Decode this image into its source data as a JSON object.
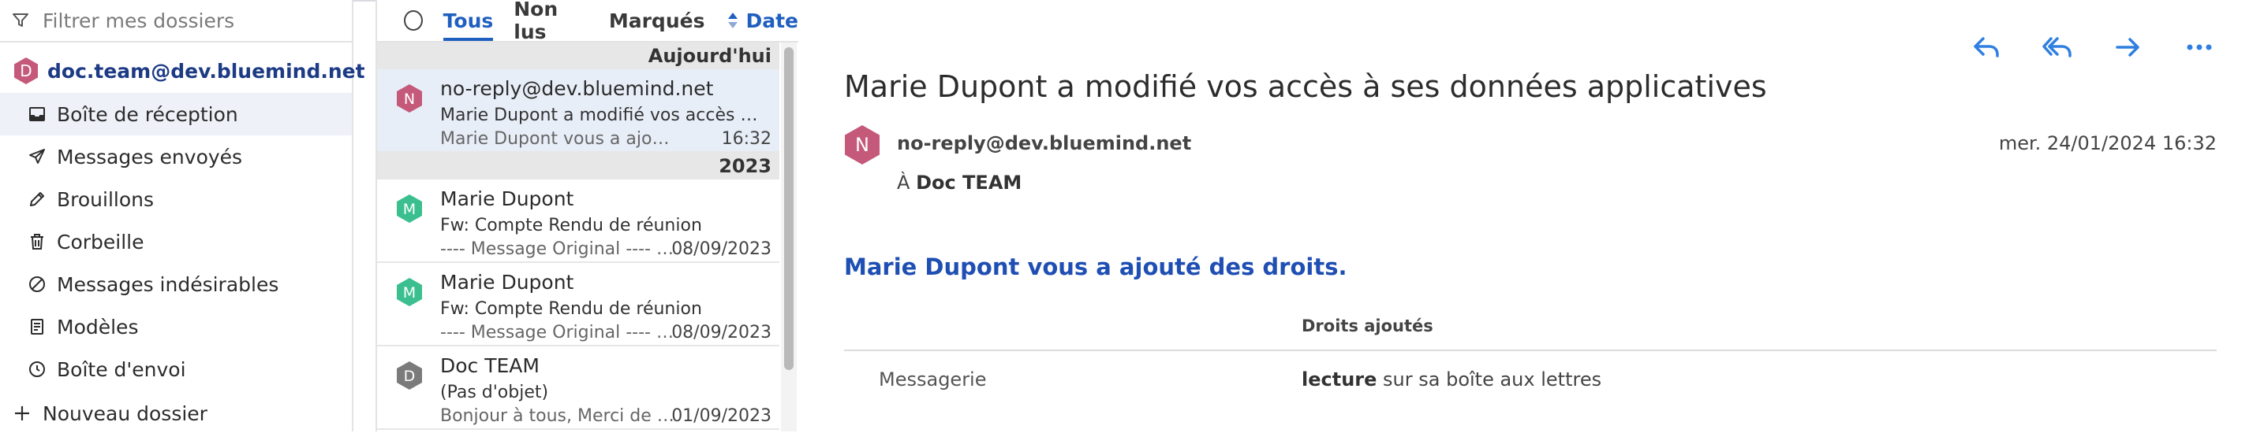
{
  "sidebar": {
    "filter_placeholder": "Filtrer mes dossiers",
    "account": {
      "name": "doc.team@dev.bluemind.net",
      "initial": "D",
      "color": "#c4597a"
    },
    "folders": [
      {
        "label": "Boîte de réception",
        "icon": "inbox-icon",
        "active": true
      },
      {
        "label": "Messages envoyés",
        "icon": "paper-plane-icon"
      },
      {
        "label": "Brouillons",
        "icon": "pencil-icon"
      },
      {
        "label": "Corbeille",
        "icon": "trash-icon"
      },
      {
        "label": "Messages indésirables",
        "icon": "ban-icon"
      },
      {
        "label": "Modèles",
        "icon": "template-icon"
      },
      {
        "label": "Boîte d'envoi",
        "icon": "clock-icon"
      }
    ],
    "new_folder_label": "Nouveau dossier"
  },
  "list": {
    "tabs": [
      "Tous",
      "Non lus",
      "Marqués"
    ],
    "active_tab": "Tous",
    "sort_label": "Date",
    "groups": [
      {
        "label": "Aujourd'hui",
        "mails": [
          {
            "initial": "N",
            "color": "#c4597a",
            "from": "no-reply@dev.bluemind.net",
            "subject": "Marie Dupont a modifié vos accès à ses données applicatives",
            "preview": "Marie Dupont vous a ajouté des droits.",
            "date": "16:32",
            "selected": true
          }
        ]
      },
      {
        "label": "2023",
        "mails": [
          {
            "initial": "M",
            "color": "#3bbf8e",
            "from": "Marie Dupont",
            "subject": "Fw: Compte Rendu de réunion",
            "preview": "---- Message Original ---- De : Marie Dupont",
            "date": "08/09/2023"
          },
          {
            "initial": "M",
            "color": "#3bbf8e",
            "from": "Marie Dupont",
            "subject": "Fw: Compte Rendu de réunion",
            "preview": "---- Message Original ---- De : Marie Dupont",
            "date": "08/09/2023"
          },
          {
            "initial": "D",
            "color": "#7b7b7b",
            "from": "Doc TEAM",
            "subject": "(Pas d'objet)",
            "preview": "Bonjour à tous, Merci de votre participation",
            "date": "01/09/2023"
          }
        ]
      }
    ]
  },
  "reader": {
    "subject": "Marie Dupont a modifié vos accès à ses données applicatives",
    "sender": {
      "initial": "N",
      "color": "#c4597a",
      "email": "no-reply@dev.bluemind.net"
    },
    "to_prefix": "À",
    "to_name": "Doc TEAM",
    "datetime": "mer. 24/01/2024 16:32",
    "body_heading": "Marie Dupont vous a ajouté des droits.",
    "rights_column_header": "Droits ajoutés",
    "rights_row": {
      "name": "Messagerie",
      "right_bold": "lecture",
      "right_rest": " sur sa boîte aux lettres"
    },
    "actions": [
      "reply-icon",
      "reply-all-icon",
      "forward-icon",
      "more-icon"
    ]
  },
  "colors": {
    "accent": "#1f5fbf",
    "heading": "#1f4fb3",
    "account": "#1d3b85"
  }
}
